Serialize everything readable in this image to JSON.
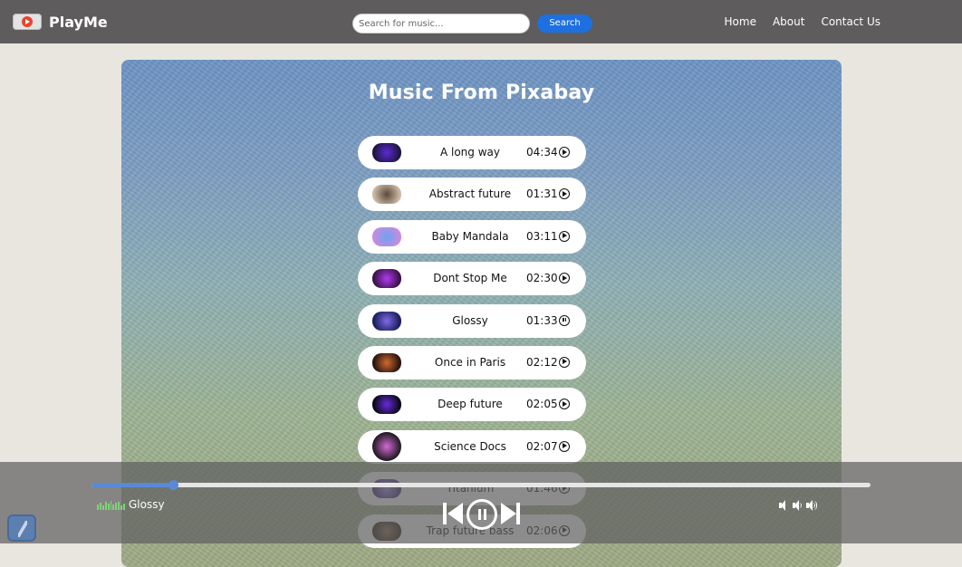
{
  "navbar": {
    "brand": "PlayMe",
    "search": {
      "placeholder": "Search for music...",
      "value": ""
    },
    "search_button": "Search",
    "links": [
      "Home",
      "About",
      "Contact Us"
    ]
  },
  "card": {
    "title": "Music From Pixabay",
    "tracks": [
      {
        "name": "A long way",
        "duration": "04:34",
        "state": "play",
        "thumb_colors": [
          "#1e1640",
          "#5d2ad8"
        ]
      },
      {
        "name": "Abstract future",
        "duration": "01:31",
        "state": "play",
        "thumb_colors": [
          "#cbb9a5",
          "#5b4a3a"
        ]
      },
      {
        "name": "Baby Mandala",
        "duration": "03:11",
        "state": "play",
        "thumb_colors": [
          "#c98ae0",
          "#6aa4f0"
        ]
      },
      {
        "name": "Dont Stop Me",
        "duration": "02:30",
        "state": "play",
        "thumb_colors": [
          "#3a1248",
          "#b03af0"
        ]
      },
      {
        "name": "Glossy",
        "duration": "01:33",
        "state": "pause",
        "thumb_colors": [
          "#1b1f5c",
          "#7e6ae8"
        ]
      },
      {
        "name": "Once in Paris",
        "duration": "02:12",
        "state": "play",
        "thumb_colors": [
          "#2a1410",
          "#d06a30"
        ]
      },
      {
        "name": "Deep future",
        "duration": "02:05",
        "state": "play",
        "thumb_colors": [
          "#0a0a18",
          "#6a2ae0"
        ]
      },
      {
        "name": "Science Docs",
        "duration": "02:07",
        "state": "play",
        "thumb_colors": [
          "#111111",
          "#d26ad6"
        ]
      },
      {
        "name": "Titanium",
        "duration": "01:46",
        "state": "play",
        "thumb_colors": [
          "#3a2a70",
          "#a07af0"
        ]
      },
      {
        "name": "Trap future bass",
        "duration": "02:06",
        "state": "play",
        "thumb_colors": [
          "#2a1a12",
          "#8a6a4a"
        ]
      }
    ]
  },
  "player": {
    "now_playing": "Glossy",
    "progress": 0.105
  },
  "colors": {
    "navbar": "#5e5c5c",
    "accent": "#1e6fe0",
    "progress": "#5a89d6"
  }
}
